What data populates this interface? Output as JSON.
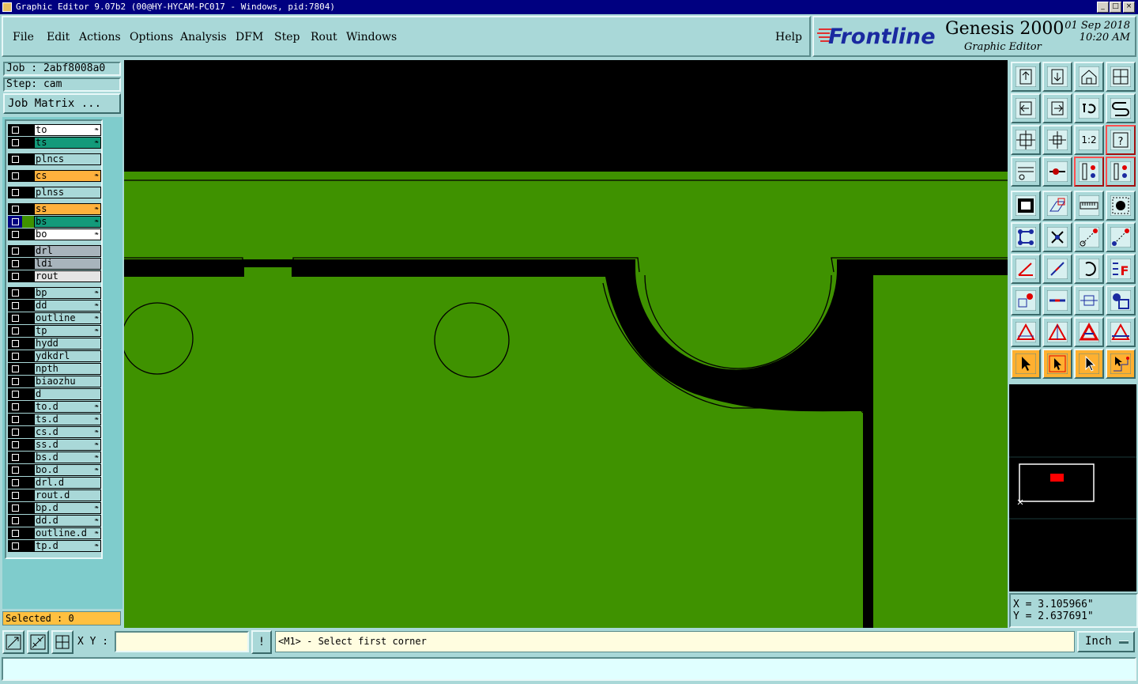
{
  "window": {
    "title": "Graphic Editor 9.07b2 (00@HY-HYCAM-PC017 - Windows, pid:7804)",
    "min_label": "_",
    "max_label": "□",
    "close_label": "×"
  },
  "menu": {
    "file": "File",
    "edit": "Edit",
    "actions": "Actions",
    "options": "Options",
    "analysis": "Analysis",
    "dfm": "DFM",
    "step": "Step",
    "rout": "Rout",
    "windows": "Windows",
    "help": "Help"
  },
  "brand": {
    "logo": "Frontline",
    "product": "Genesis 2000",
    "subtitle": "Graphic Editor",
    "date": "01 Sep 2018",
    "time": "10:20 AM"
  },
  "job": {
    "job_line": "Job : 2abf8008a0",
    "step_line": "Step: cam",
    "matrix_button": "Job Matrix ..."
  },
  "layers": [
    {
      "name": "to",
      "color": "#ffffff",
      "arrow": true,
      "group": 0
    },
    {
      "name": "ts",
      "color": "#139a7a",
      "arrow": true,
      "group": 0
    },
    {
      "name": "plncs",
      "color": "#a9d8d8",
      "arrow": false,
      "group": 1
    },
    {
      "name": "cs",
      "color": "#ffb13d",
      "arrow": true,
      "group": 2
    },
    {
      "name": "plnss",
      "color": "#a9d8d8",
      "arrow": false,
      "group": 3
    },
    {
      "name": "ss",
      "color": "#ffb13d",
      "arrow": true,
      "group": 4
    },
    {
      "name": "bs",
      "color": "#139a7a",
      "arrow": true,
      "group": 4,
      "active": true
    },
    {
      "name": "bo",
      "color": "#ffffff",
      "arrow": true,
      "group": 4
    },
    {
      "name": "drl",
      "color": "#a8b4bc",
      "arrow": false,
      "group": 5
    },
    {
      "name": "ldi",
      "color": "#a8b4bc",
      "arrow": false,
      "group": 5
    },
    {
      "name": "rout",
      "color": "#e4e4e4",
      "arrow": false,
      "group": 5
    },
    {
      "name": "bp",
      "color": "#a9d8d8",
      "arrow": true,
      "group": 6
    },
    {
      "name": "dd",
      "color": "#a9d8d8",
      "arrow": true,
      "group": 6
    },
    {
      "name": "outline",
      "color": "#a9d8d8",
      "arrow": true,
      "group": 6
    },
    {
      "name": "tp",
      "color": "#a9d8d8",
      "arrow": true,
      "group": 6
    },
    {
      "name": "hydd",
      "color": "#a9d8d8",
      "arrow": false,
      "group": 6
    },
    {
      "name": "ydkdrl",
      "color": "#a9d8d8",
      "arrow": false,
      "group": 6
    },
    {
      "name": "npth",
      "color": "#a9d8d8",
      "arrow": false,
      "group": 6
    },
    {
      "name": "biaozhu",
      "color": "#a9d8d8",
      "arrow": false,
      "group": 6
    },
    {
      "name": "d",
      "color": "#a9d8d8",
      "arrow": false,
      "group": 6
    },
    {
      "name": "to.d",
      "color": "#a9d8d8",
      "arrow": true,
      "group": 6
    },
    {
      "name": "ts.d",
      "color": "#a9d8d8",
      "arrow": true,
      "group": 6
    },
    {
      "name": "cs.d",
      "color": "#a9d8d8",
      "arrow": true,
      "group": 6
    },
    {
      "name": "ss.d",
      "color": "#a9d8d8",
      "arrow": true,
      "group": 6
    },
    {
      "name": "bs.d",
      "color": "#a9d8d8",
      "arrow": true,
      "group": 6
    },
    {
      "name": "bo.d",
      "color": "#a9d8d8",
      "arrow": true,
      "group": 6
    },
    {
      "name": "drl.d",
      "color": "#a9d8d8",
      "arrow": false,
      "group": 6
    },
    {
      "name": "rout.d",
      "color": "#a9d8d8",
      "arrow": false,
      "group": 6
    },
    {
      "name": "bp.d",
      "color": "#a9d8d8",
      "arrow": true,
      "group": 6
    },
    {
      "name": "dd.d",
      "color": "#a9d8d8",
      "arrow": true,
      "group": 6
    },
    {
      "name": "outline.d",
      "color": "#a9d8d8",
      "arrow": true,
      "group": 6
    },
    {
      "name": "tp.d",
      "color": "#a9d8d8",
      "arrow": true,
      "group": 6
    }
  ],
  "selected": "Selected : 0",
  "canvas": {
    "copper_color": "#3f9200",
    "background_color": "#000000"
  },
  "toolbar": {
    "scale_label": "1:2",
    "help_label": "?",
    "icons": [
      "pan-up-icon",
      "pan-down-icon",
      "home-icon",
      "window-split-icon",
      "pan-left-icon",
      "pan-right-icon",
      "undo-view-icon",
      "redraw-icon",
      "zoom-fit-icon",
      "zoom-center-icon",
      "scale-icon",
      "help-icon",
      "tools-icon",
      "snap-icon",
      "layer-compare-icon",
      "layer-settings-icon",
      "fill-icon",
      "measure-shape-icon",
      "ruler-icon",
      "pad-icon",
      "connect-icon",
      "cross-icon",
      "point-to-point-icon",
      "point-distance-icon",
      "angle-icon",
      "line-icon",
      "arc-icon",
      "fill-f-icon",
      "feature-info-icon",
      "line-remove-icon",
      "dimension-icon",
      "shapes-icon",
      "triangle-icon",
      "triangle-measure-icon",
      "triangle-bold-icon",
      "triangle-red-icon",
      "select-icon",
      "select-box-icon",
      "select-net-icon",
      "select-connection-icon"
    ]
  },
  "overview": {
    "frame_color": "#ffffff",
    "marker_color": "#ff0000"
  },
  "coords": {
    "x": "X = 3.105966\"",
    "y": "Y = 2.637691\""
  },
  "bottom": {
    "xy_label": "X Y :",
    "xy_value": "",
    "warn_label": "!",
    "prompt": "<M1> - Select first corner",
    "units": "Inch"
  },
  "status_line": ""
}
